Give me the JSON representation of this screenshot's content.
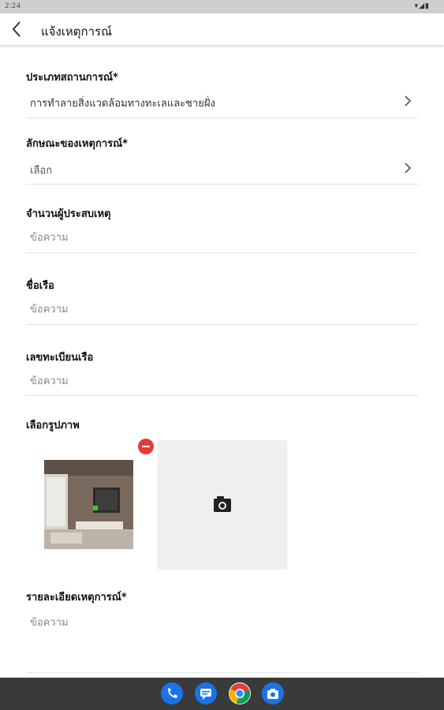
{
  "status_bar": {
    "time": "2:24",
    "indicators": "▾◢▮"
  },
  "app_bar": {
    "title": "แจ้งเหตุการณ์",
    "back_icon": "arrow-back-icon"
  },
  "form": {
    "situation_type": {
      "label": "ประเภทสถานการณ์*",
      "value": "การทำลายสิ่งแวดล้อมทางทะเลและชายฝั่ง"
    },
    "incident_nature": {
      "label": "ลักษณะของเหตุการณ์*",
      "value": "เลือก"
    },
    "victims_count": {
      "label": "จำนวนผู้ประสบเหตุ",
      "placeholder": "ข้อความ"
    },
    "ship_name": {
      "label": "ชื่อเรือ",
      "placeholder": "ข้อความ"
    },
    "ship_registration": {
      "label": "เลขทะเบียนเรือ",
      "placeholder": "ข้อความ"
    },
    "images": {
      "label": "เลือกรูปภาพ"
    },
    "incident_details": {
      "label": "รายละเอียดเหตุการณ์*",
      "placeholder": "ข้อความ"
    }
  },
  "colors": {
    "remove_badge": "#e53935",
    "nav_bar": "#3a3a3a",
    "add_tile": "#efefef"
  },
  "dock_icons": [
    "phone-icon",
    "messages-icon",
    "chrome-icon",
    "camera-icon"
  ]
}
